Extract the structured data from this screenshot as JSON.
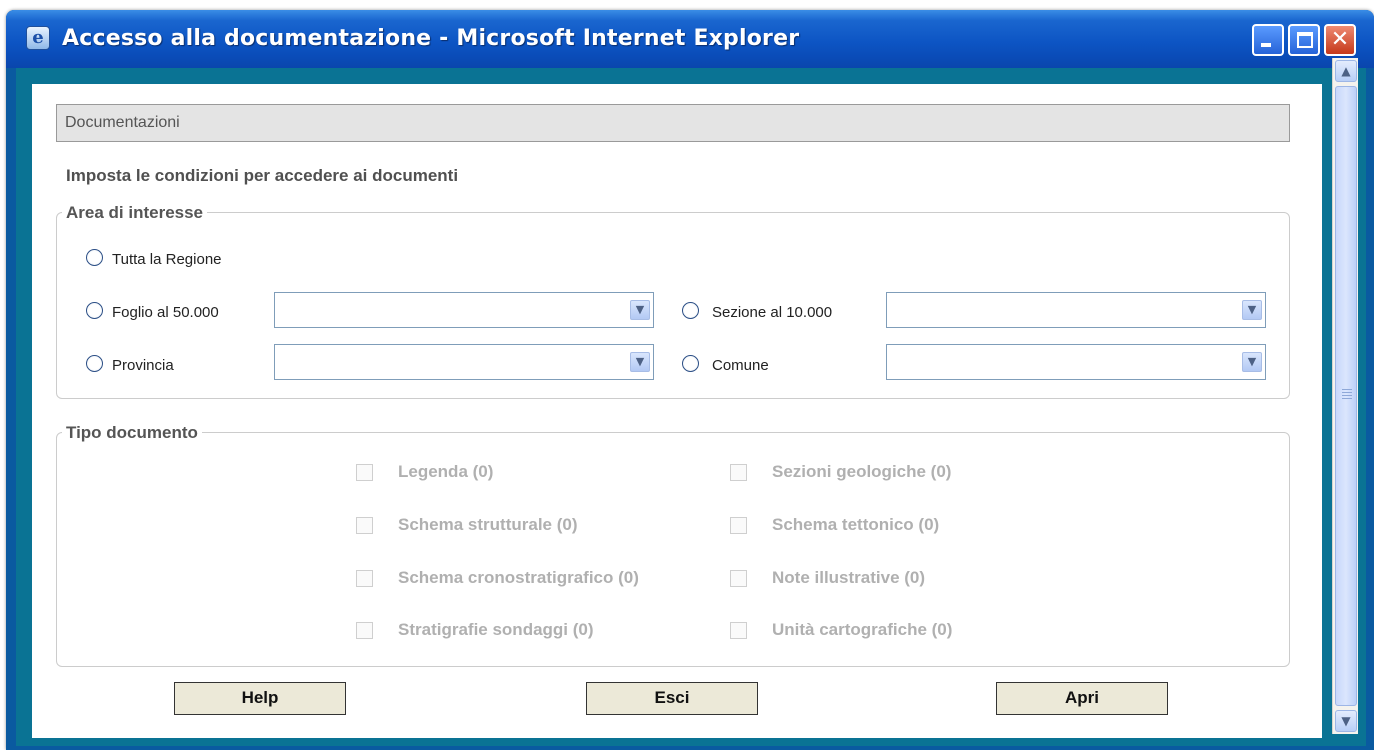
{
  "window": {
    "title": "Accesso alla documentazione - Microsoft Internet Explorer",
    "icon": "ie-page-icon",
    "controls": [
      "minimize-icon",
      "maximize-icon",
      "close-icon"
    ]
  },
  "panel": {
    "header": "Documentazioni",
    "intro": "Imposta le condizioni per accedere ai documenti"
  },
  "area": {
    "legend": "Area di interesse",
    "options": {
      "tutta": "Tutta la Regione",
      "foglio": "Foglio al 50.000",
      "sezione": "Sezione al 10.000",
      "provincia": "Provincia",
      "comune": "Comune"
    },
    "values": {
      "foglio": "",
      "sezione": "",
      "provincia": "",
      "comune": ""
    }
  },
  "tipo": {
    "legend": "Tipo documento",
    "left": [
      "Legenda (0)",
      "Schema strutturale (0)",
      "Schema cronostratigrafico (0)",
      "Stratigrafie sondaggi (0)"
    ],
    "right": [
      "Sezioni geologiche (0)",
      "Schema tettonico (0)",
      "Note illustrative (0)",
      "Unità cartografiche (0)"
    ]
  },
  "buttons": {
    "help": "Help",
    "esci": "Esci",
    "apri": "Apri"
  },
  "colors": {
    "title_bar": "#0d55c4",
    "client_border": "#0a7394",
    "button_face": "#ece9d8",
    "disabled_text": "#b0b0b0"
  }
}
